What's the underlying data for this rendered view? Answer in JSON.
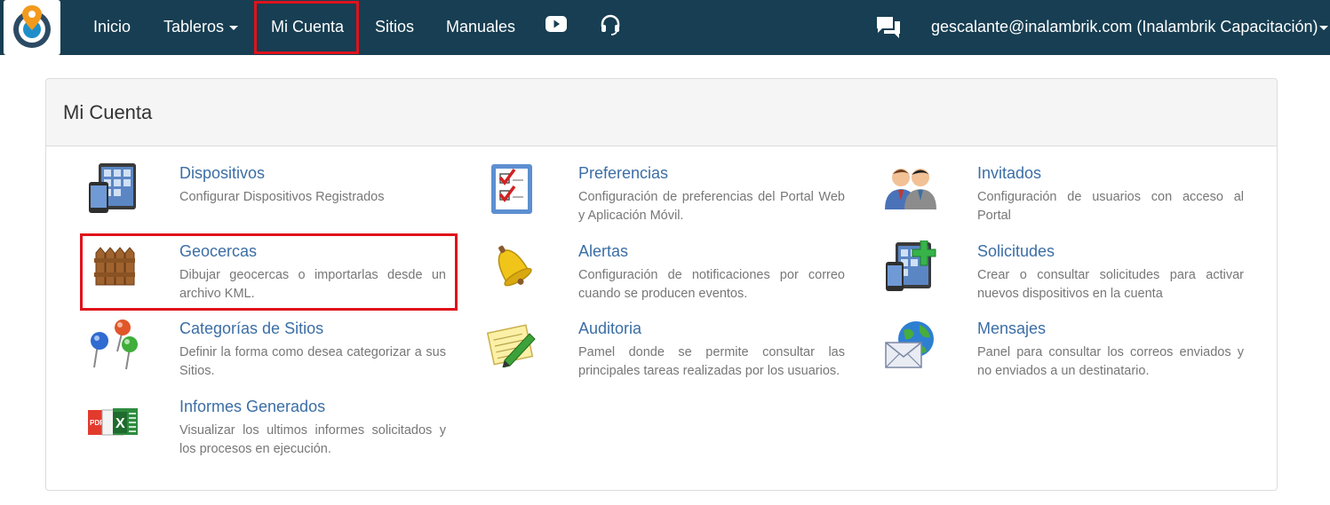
{
  "navbar": {
    "items": [
      {
        "label": "Inicio"
      },
      {
        "label": "Tableros"
      },
      {
        "label": "Mi Cuenta"
      },
      {
        "label": "Sitios"
      },
      {
        "label": "Manuales"
      }
    ],
    "icons": [
      "youtube-icon",
      "headset-icon",
      "chat-icon"
    ],
    "user": "gescalante@inalambrik.com (Inalambrik Capacitación)",
    "colors": {
      "background": "#173e52",
      "highlight": "#e0121b"
    }
  },
  "panel": {
    "title": "Mi Cuenta",
    "items": [
      {
        "title": "Dispositivos",
        "desc": "Configurar Dispositivos Registrados",
        "icon": "devices-icon"
      },
      {
        "title": "Preferencias",
        "desc": "Configuración de preferencias del Portal Web y Aplicación Móvil.",
        "icon": "checklist-icon"
      },
      {
        "title": "Invitados",
        "desc": "Configuración de usuarios con acceso al Portal",
        "icon": "users-icon"
      },
      {
        "title": "Geocercas",
        "desc": "Dibujar geocercas o importarlas desde un archivo KML.",
        "icon": "fence-icon"
      },
      {
        "title": "Alertas",
        "desc": "Configuración de notificaciones por correo cuando se producen eventos.",
        "icon": "bell-icon"
      },
      {
        "title": "Solicitudes",
        "desc": "Crear o consultar solicitudes para activar nuevos dispositivos en la cuenta",
        "icon": "add-device-icon"
      },
      {
        "title": "Categorías de Sitios",
        "desc": "Definir la forma como desea categorizar a sus Sitios.",
        "icon": "pins-icon"
      },
      {
        "title": "Auditoria",
        "desc": "Pamel donde se permite consultar las principales tareas realizadas por los usuarios.",
        "icon": "notepad-icon"
      },
      {
        "title": "Mensajes",
        "desc": "Panel para consultar los correos enviados y no enviados a un destinatario.",
        "icon": "mail-globe-icon"
      },
      {
        "title": "Informes Generados",
        "desc": "Visualizar los ultimos informes solicitados y los procesos en ejecución.",
        "icon": "reports-icon"
      }
    ],
    "report_badges": [
      "PDF",
      "X"
    ]
  }
}
